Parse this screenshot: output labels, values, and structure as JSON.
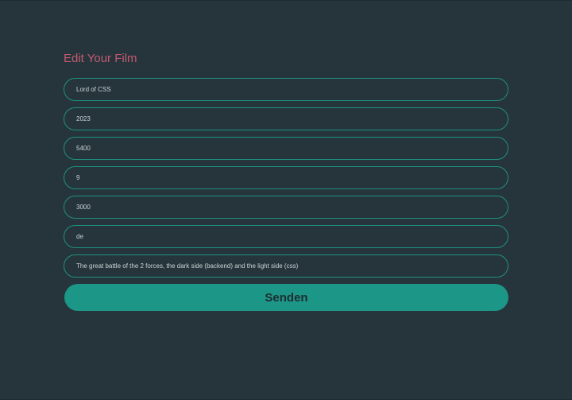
{
  "form": {
    "title": "Edit Your Film",
    "fields": [
      {
        "value": "Lord of CSS"
      },
      {
        "value": "2023"
      },
      {
        "value": "5400"
      },
      {
        "value": "9"
      },
      {
        "value": "3000"
      },
      {
        "value": "de"
      },
      {
        "value": "The great battle of the 2 forces, the dark side (backend) and the light side (css)"
      }
    ],
    "submit_label": "Senden"
  },
  "colors": {
    "background": "#26353c",
    "title": "#c35a6f",
    "field_border": "#1f8f7f",
    "button": "#1c9686",
    "button_text": "#1f2c32"
  }
}
